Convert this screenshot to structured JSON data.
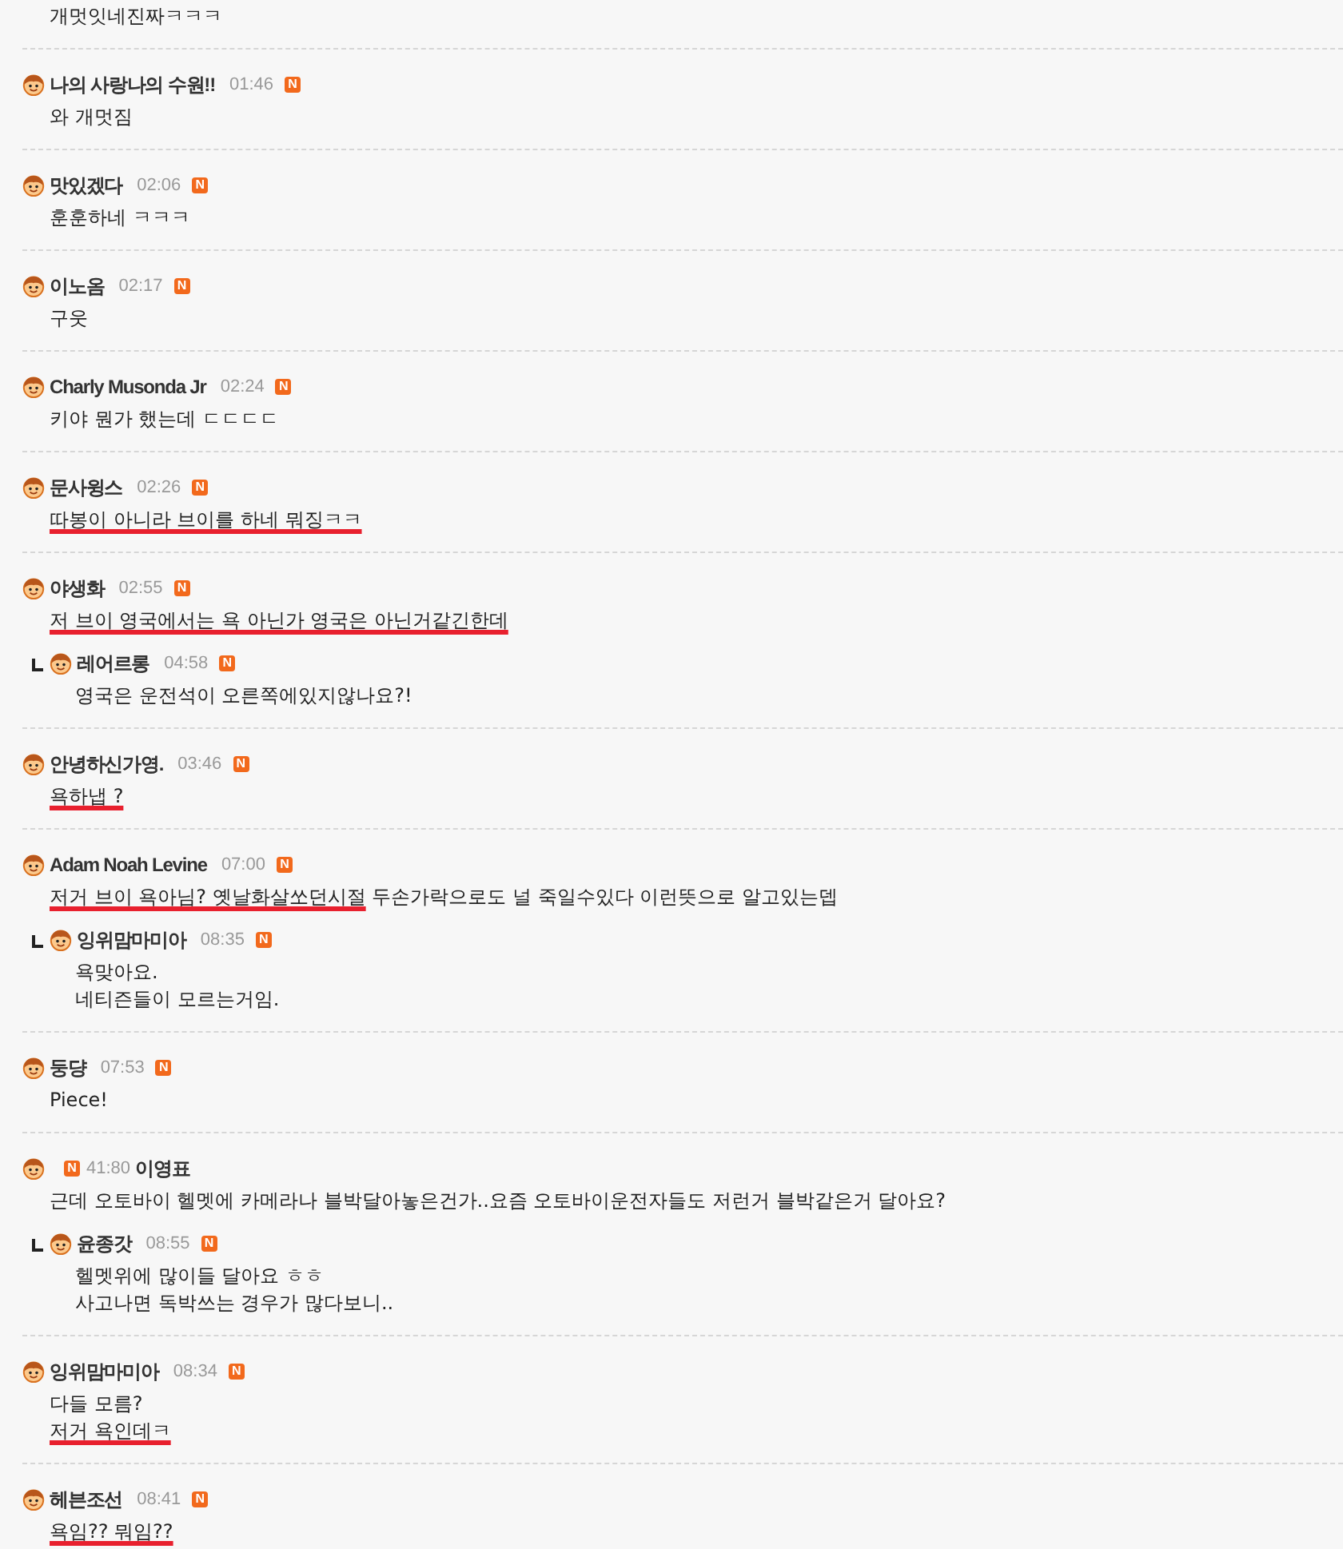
{
  "comments": [
    {
      "kind": "cut_off",
      "lines": [
        [
          {
            "text": "개멋잇네진짜ㅋㅋㅋ",
            "marked": false
          }
        ]
      ]
    },
    {
      "kind": "normal",
      "author": "나의 사랑나의 수원!!",
      "time": "01:46",
      "badge": "N",
      "lines": [
        [
          {
            "text": "와 개멋짐",
            "marked": false
          }
        ]
      ]
    },
    {
      "kind": "normal",
      "author": "맛있겠다",
      "time": "02:06",
      "badge": "N",
      "lines": [
        [
          {
            "text": "훈훈하네 ㅋㅋㅋ",
            "marked": false
          }
        ]
      ]
    },
    {
      "kind": "normal",
      "author": "이노옴",
      "time": "02:17",
      "badge": "N",
      "lines": [
        [
          {
            "text": "구웃",
            "marked": false
          }
        ]
      ]
    },
    {
      "kind": "normal",
      "author": "Charly Musonda Jr",
      "time": "02:24",
      "badge": "N",
      "lines": [
        [
          {
            "text": "키야 뭔가 했는데 ㄷㄷㄷㄷ",
            "marked": false
          }
        ]
      ]
    },
    {
      "kind": "normal",
      "author": "문사윙스",
      "time": "02:26",
      "badge": "N",
      "lines": [
        [
          {
            "text": "따봉이 아니라 브이를 하네 뭐징ㅋㅋ",
            "marked": true
          }
        ]
      ]
    },
    {
      "kind": "normal",
      "author": "야생화",
      "time": "02:55",
      "badge": "N",
      "lines": [
        [
          {
            "text": "저 브이 영국에서는 욕 아닌가 영국은 아닌거같긴한데",
            "marked": true
          }
        ]
      ],
      "replies": [
        {
          "author": "레어르롱",
          "time": "04:58",
          "badge": "N",
          "lines": [
            [
              {
                "text": "영국은 운전석이 오른쪽에있지않나요?!",
                "marked": false
              }
            ]
          ]
        }
      ]
    },
    {
      "kind": "normal",
      "author": "안녕하신가영.",
      "time": "03:46",
      "badge": "N",
      "lines": [
        [
          {
            "text": "욕하냅 ?",
            "marked": true
          }
        ]
      ]
    },
    {
      "kind": "normal",
      "author": "Adam Noah Levine",
      "time": "07:00",
      "badge": "N",
      "lines": [
        [
          {
            "text": "저거 브이 욕아님? 옛날화살쏘던시절",
            "marked": true
          },
          {
            "text": " 두손가락으로도 널 죽일수있다 이런뜻으로 알고있는뎁",
            "marked": false
          }
        ]
      ],
      "replies": [
        {
          "author": "잉위맘마미아",
          "time": "08:35",
          "badge": "N",
          "lines": [
            [
              {
                "text": "욕맞아요.",
                "marked": false
              }
            ],
            [
              {
                "text": "네티즌들이 모르는거임.",
                "marked": false
              }
            ]
          ]
        }
      ]
    },
    {
      "kind": "normal",
      "author": "둥댱",
      "time": "07:53",
      "badge": "N",
      "lines": [
        [
          {
            "text": "Piece!",
            "marked": false
          }
        ]
      ]
    },
    {
      "kind": "reversed",
      "author": "이영표",
      "time": "41:80",
      "badge": "N",
      "lines": [
        [
          {
            "text": "근데 오토바이 헬멧에 카메라나 블박달아놓은건가..요즘 오토바이운전자들도 저런거 블박같은거 달아요?",
            "marked": false
          }
        ]
      ],
      "replies": [
        {
          "author": "윤종갓",
          "time": "08:55",
          "badge": "N",
          "lines": [
            [
              {
                "text": "헬멧위에 많이들 달아요 ㅎㅎ",
                "marked": false
              }
            ],
            [
              {
                "text": "사고나면 독박쓰는 경우가 많다보니..",
                "marked": false
              }
            ]
          ]
        }
      ]
    },
    {
      "kind": "normal",
      "author": "잉위맘마미아",
      "time": "08:34",
      "badge": "N",
      "lines": [
        [
          {
            "text": "다들 모름?",
            "marked": false
          }
        ],
        [
          {
            "text": "저거 욕인데ㅋ",
            "marked": true
          }
        ]
      ]
    },
    {
      "kind": "normal",
      "author": "헤븐조선",
      "time": "08:41",
      "badge": "N",
      "lines": [
        [
          {
            "text": "욕임?? 뭐임??",
            "marked": true
          }
        ]
      ]
    }
  ]
}
